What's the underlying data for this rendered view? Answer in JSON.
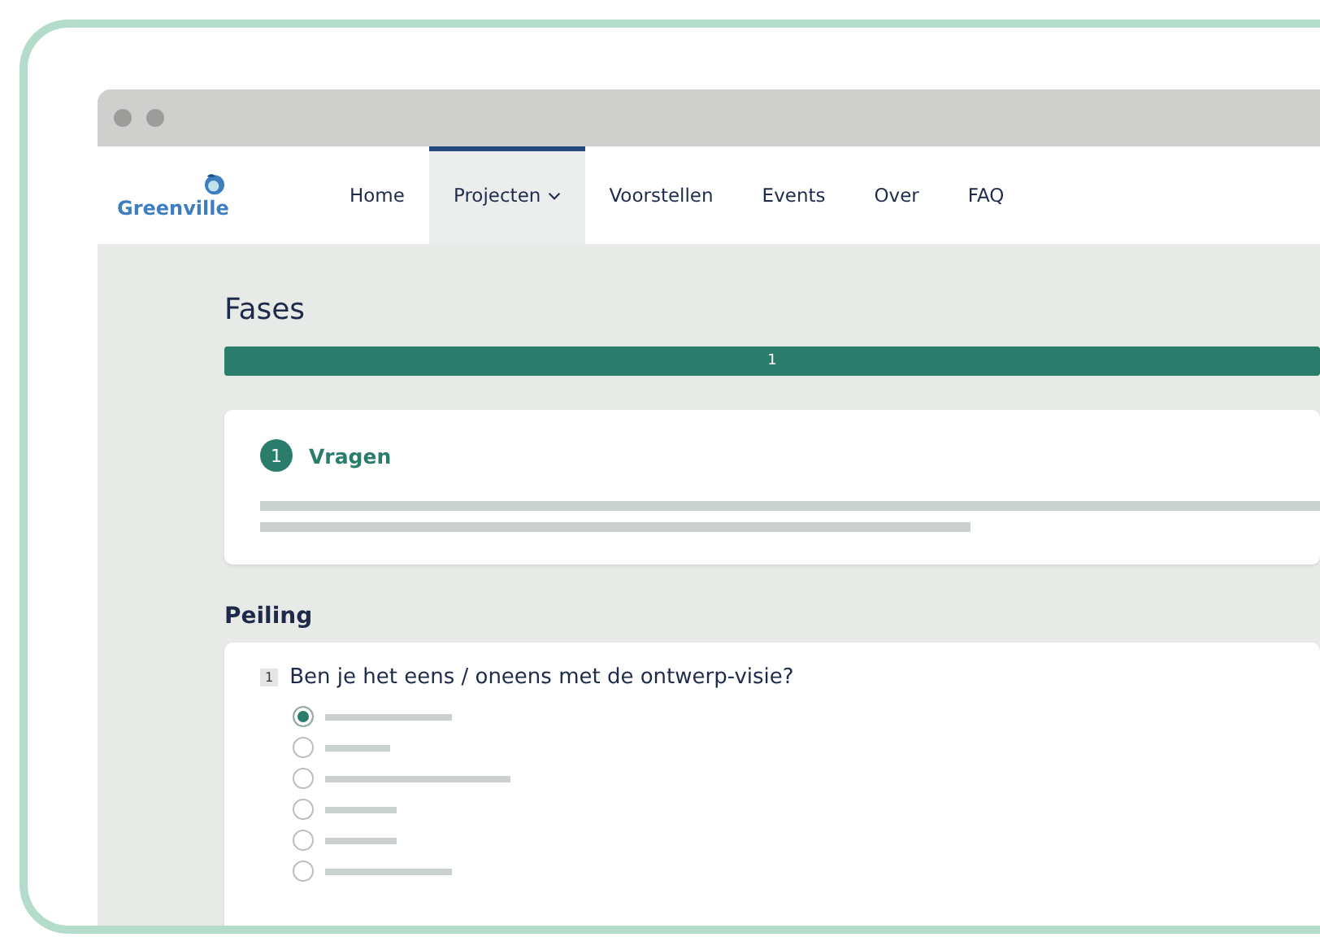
{
  "logo": {
    "text": "Greenville"
  },
  "nav": [
    {
      "label": "Home",
      "selected": false,
      "dropdown": false
    },
    {
      "label": "Projecten",
      "selected": true,
      "dropdown": true
    },
    {
      "label": "Voorstellen",
      "selected": false,
      "dropdown": false
    },
    {
      "label": "Events",
      "selected": false,
      "dropdown": false
    },
    {
      "label": "Over",
      "selected": false,
      "dropdown": false
    },
    {
      "label": "FAQ",
      "selected": false,
      "dropdown": false
    }
  ],
  "phases": {
    "title": "Fases",
    "steps": [
      {
        "label": "1",
        "selected": true
      }
    ],
    "current": {
      "number": "1",
      "title": "Vragen"
    }
  },
  "poll": {
    "title": "Peiling",
    "questions": [
      {
        "number": "1",
        "text": "Ben je het eens / oneens met de ontwerp-visie?",
        "options": [
          {
            "selected": true
          },
          {
            "selected": false
          },
          {
            "selected": false
          },
          {
            "selected": false
          },
          {
            "selected": false
          },
          {
            "selected": false
          }
        ]
      }
    ]
  }
}
